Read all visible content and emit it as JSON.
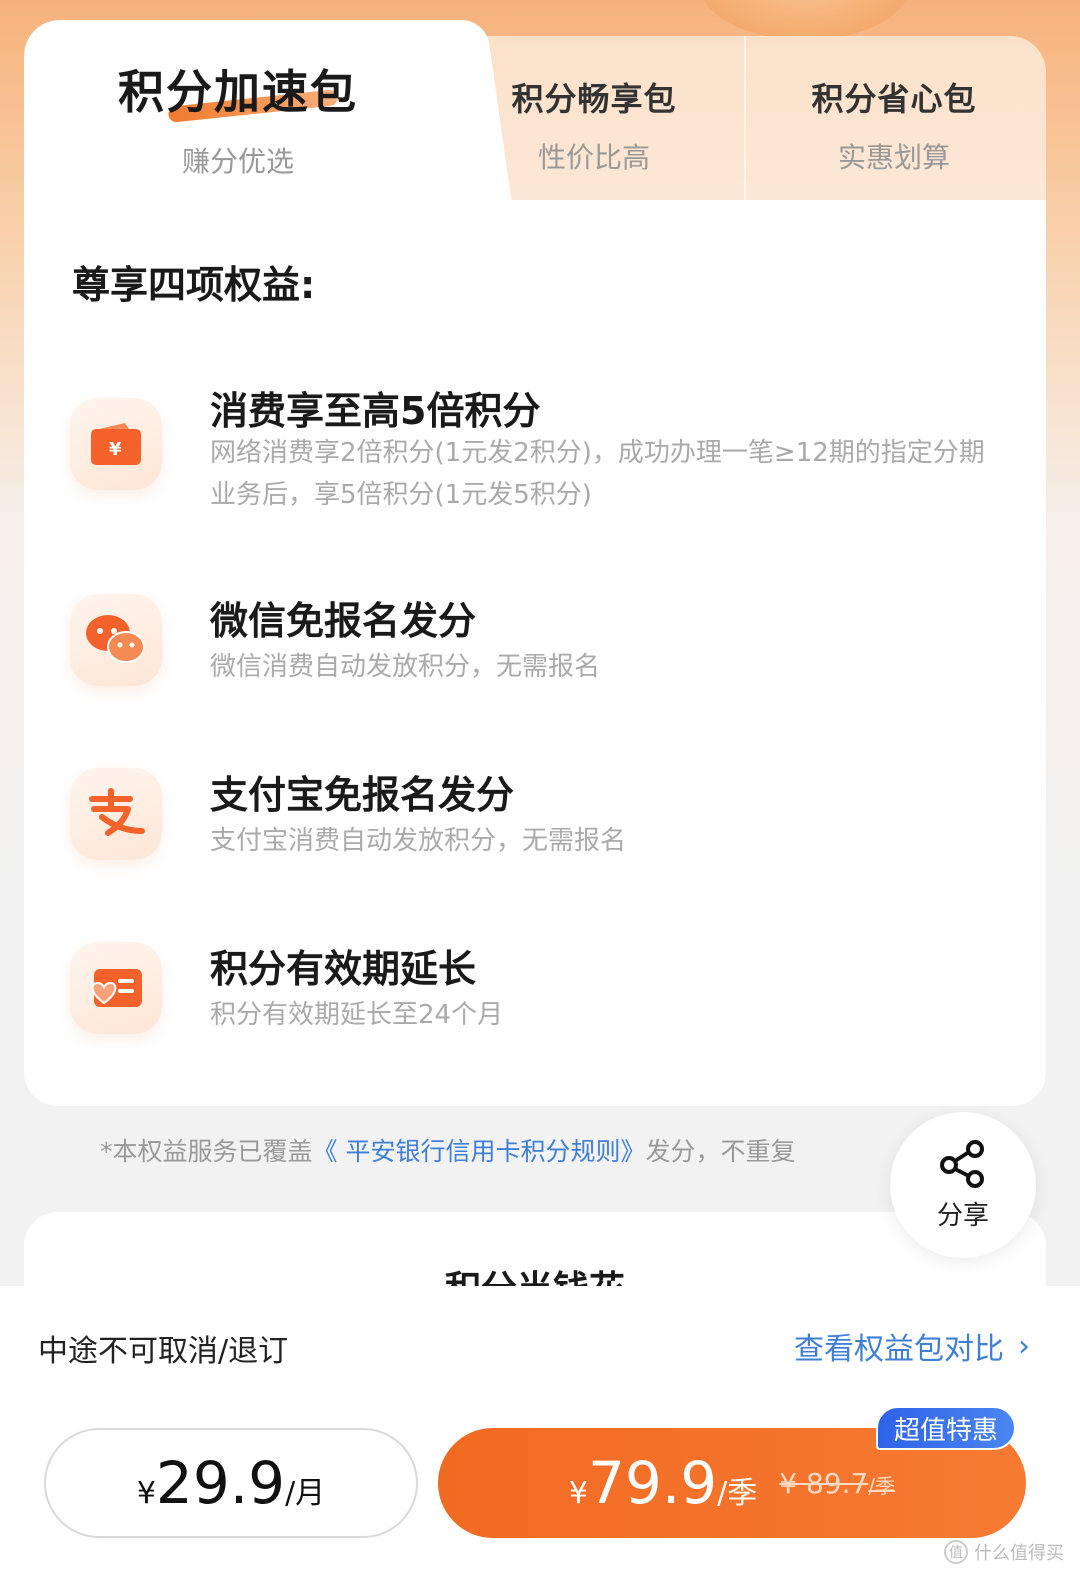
{
  "tabs": [
    {
      "title": "积分加速包",
      "subtitle": "赚分优选",
      "active": true
    },
    {
      "title": "积分畅享包",
      "subtitle": "性价比高",
      "active": false
    },
    {
      "title": "积分省心包",
      "subtitle": "实惠划算",
      "active": false
    }
  ],
  "benefits": {
    "heading": "尊享四项权益:",
    "items": [
      {
        "title": "消费享至高5倍积分",
        "desc": "网络消费享2倍积分(1元发2积分)，成功办理一笔≥12期的指定分期业务后，享5倍积分(1元发5积分)",
        "icon": "wallet-yen-icon"
      },
      {
        "title": "微信免报名发分",
        "desc": "微信消费自动发放积分，无需报名",
        "icon": "wechat-icon"
      },
      {
        "title": "支付宝免报名发分",
        "desc": "支付宝消费自动发放积分，无需报名",
        "icon": "alipay-icon"
      },
      {
        "title": "积分有效期延长",
        "desc": "积分有效期延长至24个月",
        "icon": "heart-card-icon"
      }
    ]
  },
  "note": {
    "prefix": "*本权益服务已覆盖",
    "link": "《 平安银行信用卡积分规则》",
    "suffix": "发分，不重复"
  },
  "share": {
    "label": "分享"
  },
  "section2": {
    "title": "积分当钱花"
  },
  "bottom": {
    "notice": "中途不可取消/退订",
    "compare": "查看权益包对比",
    "monthly": {
      "currency": "¥",
      "amount": "29.9",
      "unit": "/月"
    },
    "quarterly": {
      "currency": "¥",
      "amount": "79.9",
      "unit": "/季",
      "old_price": "¥ 89.7",
      "old_unit": "/季"
    },
    "badge": "超值特惠"
  },
  "watermark": {
    "text": "什么值得买",
    "mark": "值"
  },
  "colors": {
    "accent": "#f16a22",
    "link": "#3f7fd6",
    "badge": "#2e62e8"
  }
}
